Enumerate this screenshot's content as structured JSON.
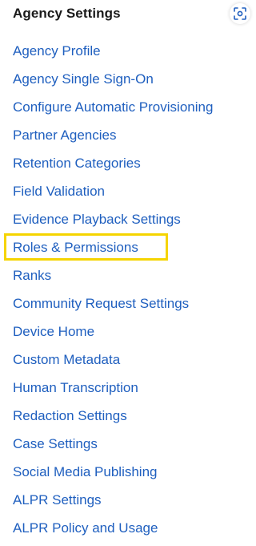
{
  "panel": {
    "title": "Agency Settings",
    "toggle_icon": "scan-focus-icon"
  },
  "nav": {
    "items": [
      {
        "label": "Agency Profile"
      },
      {
        "label": "Agency Single Sign-On"
      },
      {
        "label": "Configure Automatic Provisioning"
      },
      {
        "label": "Partner Agencies"
      },
      {
        "label": "Retention Categories"
      },
      {
        "label": "Field Validation"
      },
      {
        "label": "Evidence Playback Settings"
      },
      {
        "label": "Roles & Permissions"
      },
      {
        "label": "Ranks"
      },
      {
        "label": "Community Request Settings"
      },
      {
        "label": "Device Home"
      },
      {
        "label": "Custom Metadata"
      },
      {
        "label": "Human Transcription"
      },
      {
        "label": "Redaction Settings"
      },
      {
        "label": "Case Settings"
      },
      {
        "label": "Social Media Publishing"
      },
      {
        "label": "ALPR Settings"
      },
      {
        "label": "ALPR Policy and Usage"
      }
    ],
    "highlighted_item": "Roles & Permissions"
  },
  "colors": {
    "link": "#1f5fbf",
    "title": "#1a1a1a",
    "highlight": "#f5d400",
    "icon": "#1f5fbf"
  }
}
